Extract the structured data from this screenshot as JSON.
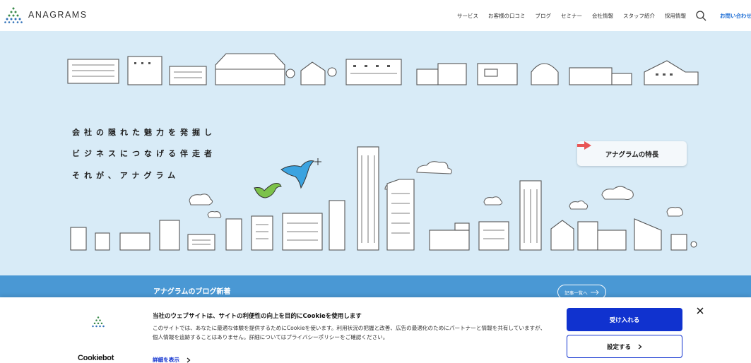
{
  "header": {
    "logo_text": "ANAGRAMS",
    "nav": [
      "サービス",
      "お客様の口コミ",
      "ブログ",
      "セミナー",
      "会社情報",
      "スタッフ紹介",
      "採用情報"
    ],
    "contact": "お問い合わせ"
  },
  "hero": {
    "taglines": [
      "会社の隠れた魅力を発掘し",
      "ビジネスにつなげる伴走者",
      "それが、アナグラム"
    ],
    "feature_button": "アナグラムの特長"
  },
  "blog": {
    "title": "アナグラムのブログ新着",
    "more": "記事一覧へ"
  },
  "cookie": {
    "title": "当社のウェブサイトは、サイトの利便性の向上を目的にCookieを使用します",
    "body": "このサイトでは、あなたに最適な体験を提供するためにCookieを使います。利用状況の把握と改善、広告の最適化のためにパートナーと情報を共有していますが、個人情報を追跡することはありません。詳細についてはプライバシーポリシーをご確認ください。",
    "detail_link": "詳細を表示",
    "accept": "受け入れる",
    "settings": "設定する",
    "brand": "Cookiebot"
  },
  "colors": {
    "hero_bg": "#d8ebf7",
    "blog_bg": "#4a98d4",
    "accent_blue": "#1032cf",
    "link_blue": "#1f6fd6"
  }
}
